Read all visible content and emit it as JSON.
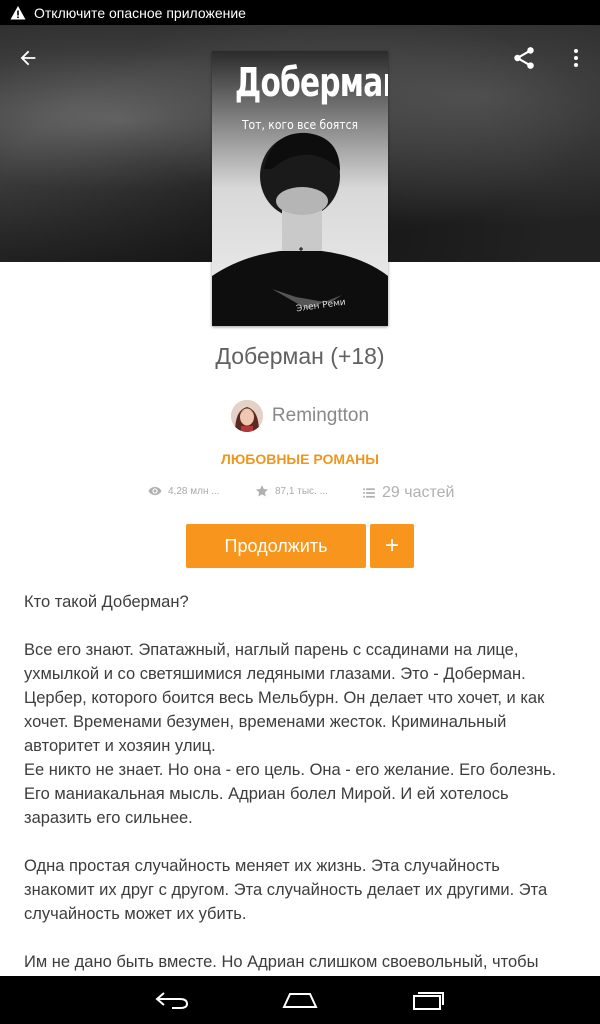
{
  "status_bar": {
    "notification": "Отключите опасное приложение",
    "icon": "warning-icon"
  },
  "app_bar": {
    "back_icon": "arrow-back-icon",
    "share_icon": "share-icon",
    "more_icon": "more-vert-icon"
  },
  "cover": {
    "title": "Доберман",
    "tagline": "Тот, кого все боятся",
    "author": "Элен Реми"
  },
  "story": {
    "title": "Доберман (+18)",
    "author": "Remingtton",
    "category": "ЛЮБОВНЫЕ РОМАНЫ",
    "reads": "4,28 млн ...",
    "votes": "87,1 тыс. ...",
    "parts": "29 частей"
  },
  "actions": {
    "continue_label": "Продолжить",
    "add_label": "+"
  },
  "description": {
    "lines": [
      "Кто такой Доберман?",
      "",
      "Все его знают. Эпатажный, наглый парень с ссадинами на лице,",
      "ухмылкой и со светяшимися ледяными глазами. Это - Доберман.",
      "Цербер, которого боится весь Мельбурн. Он делает что хочет, и как",
      "хочет. Временами безумен, временами жесток. Криминальный",
      "авторитет и хозяин улиц.",
      "Ее никто не знает. Но она - его цель. Она - его желание. Его болезнь.",
      "Его маниакальная мысль. Адриан болел Мирой. И ей хотелось",
      "заразить его сильнее.",
      "",
      "Одна простая случайность меняет их жизнь. Эта случайность",
      "знакомит их друг с другом. Эта случайность делает их другими. Эта",
      "случайность может их убить.",
      "",
      "Им не дано быть вместе. Но Адриан слишком своевольный, чтобы"
    ]
  },
  "nav_bar": {
    "back_icon": "nav-back-icon",
    "home_icon": "nav-home-icon",
    "recents_icon": "nav-recents-icon"
  },
  "colors": {
    "accent": "#f7951d",
    "category": "#f0961d",
    "text": "#3d3d3d",
    "muted": "#aaaaaa"
  }
}
